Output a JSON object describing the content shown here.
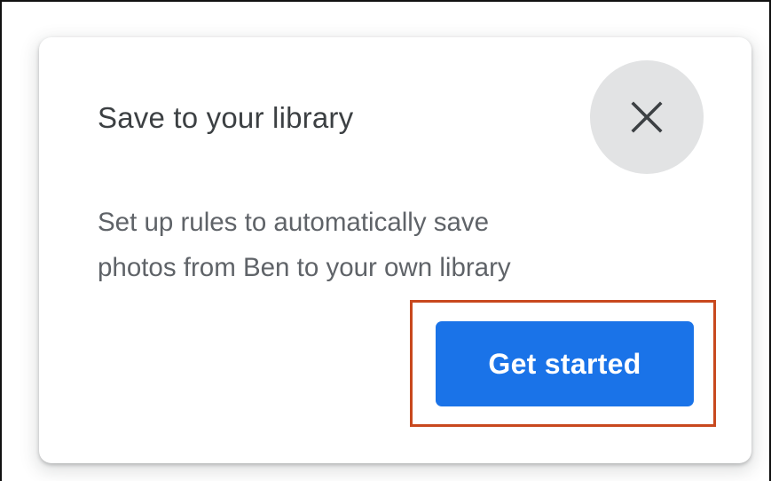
{
  "dialog": {
    "title": "Save to your library",
    "message_line1": "Set up rules to automatically save",
    "message_line2": "photos from Ben to your own library",
    "close_icon": "close-icon",
    "primary_button_label": "Get started"
  },
  "colors": {
    "primary": "#1a73e8",
    "close_button_bg": "#e2e3e4",
    "highlight_border": "#c8481e",
    "title_text": "#3c4043",
    "body_text": "#5f6368"
  }
}
